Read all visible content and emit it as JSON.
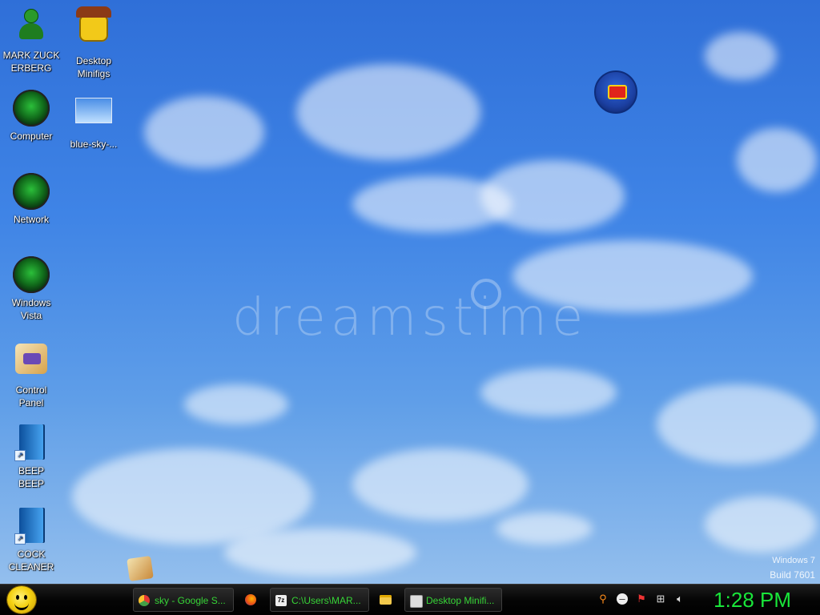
{
  "desktop": {
    "icons": [
      {
        "label": "MARK ZUCKERBERG",
        "icon": "user-folder-icon"
      },
      {
        "label": "Desktop Minifigs",
        "icon": "lego-minifig-icon"
      },
      {
        "label": "Computer",
        "icon": "computer-orb-icon"
      },
      {
        "label": "blue-sky-...",
        "icon": "image-thumbnail-icon"
      },
      {
        "label": "Network",
        "icon": "network-orb-icon"
      },
      {
        "label": "Windows Vista",
        "icon": "windows-vista-orb-icon"
      },
      {
        "label": "Control Panel",
        "icon": "control-panel-icon"
      },
      {
        "label": "BEEP BEEP",
        "icon": "shortcut-book-icon"
      },
      {
        "label": "COCK CLEANER",
        "icon": "shortcut-book-icon"
      }
    ],
    "watermark": "dreamstime",
    "os_name": "Windows 7",
    "os_build": "Build 7601"
  },
  "taskbar": {
    "start_icon": "smiley-start-icon",
    "tasks": [
      {
        "label": "sky - Google S...",
        "icon": "chrome-icon"
      },
      {
        "label": "",
        "icon": "firefox-icon"
      },
      {
        "label": "C:\\Users\\MAR...",
        "icon": "7zip-icon"
      },
      {
        "label": "",
        "icon": "folder-icon"
      },
      {
        "label": "Desktop Minifi...",
        "icon": "window-icon"
      }
    ],
    "tray_icons": [
      "search-icon",
      "minus-icon",
      "flag-icon",
      "network-icon",
      "volume-icon"
    ],
    "clock": "1:28 PM"
  },
  "colors": {
    "taskbar_text": "#36d436",
    "clock": "#19e63a"
  }
}
